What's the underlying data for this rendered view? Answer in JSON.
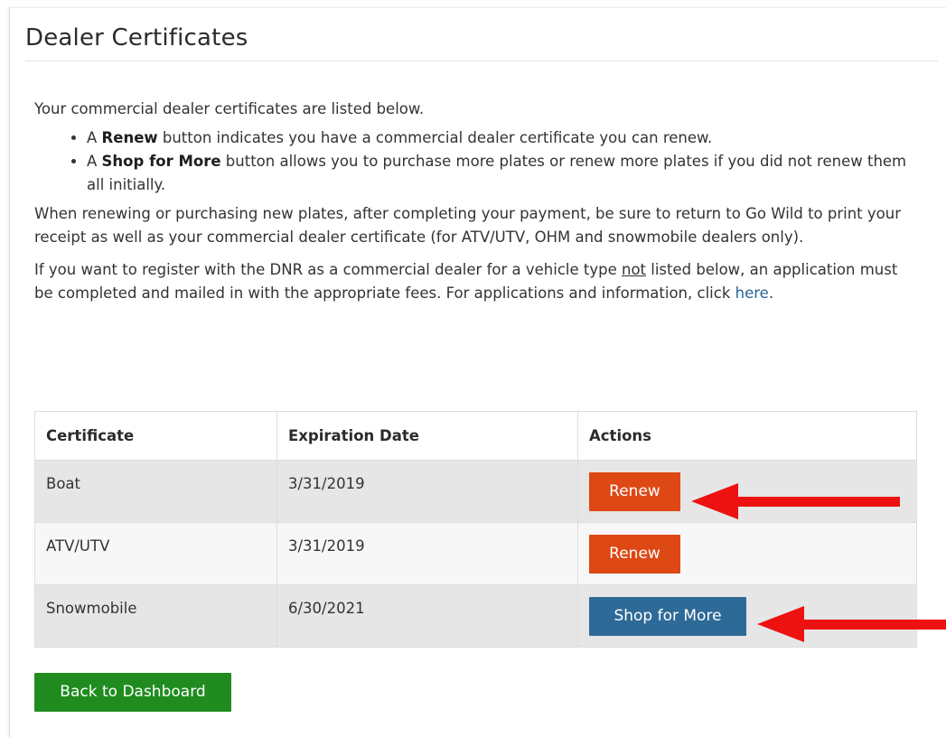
{
  "page": {
    "title": "Dealer Certificates",
    "intro": "Your commercial dealer certificates are listed below.",
    "bullets": [
      {
        "prefix": "A ",
        "bold": "Renew",
        "text": " button indicates you have a commercial dealer certificate you can renew."
      },
      {
        "prefix": "A ",
        "bold": "Shop for More",
        "text": " button allows you to purchase more plates or renew more plates if you did not renew them all initially."
      }
    ],
    "renewing_note": "When renewing or purchasing new plates, after completing your payment, be sure to return to Go Wild to print your receipt as well as your commercial dealer certificate (for ATV/UTV, OHM and snowmobile dealers only).",
    "register_note": {
      "before": "If you want to register with the DNR as a commercial dealer for a vehicle type ",
      "underlined": "not",
      "middle": " listed below, an application must be completed and mailed in with the appropriate fees. For applications and information, click ",
      "link": "here",
      "after": "."
    }
  },
  "table": {
    "headers": [
      "Certificate",
      "Expiration Date",
      "Actions"
    ],
    "rows": [
      {
        "certificate": "Boat",
        "expiration": "3/31/2019",
        "action": "Renew"
      },
      {
        "certificate": "ATV/UTV",
        "expiration": "3/31/2019",
        "action": "Renew"
      },
      {
        "certificate": "Snowmobile",
        "expiration": "6/30/2021",
        "action": "Shop for More"
      }
    ]
  },
  "buttons": {
    "back": "Back to Dashboard"
  },
  "colors": {
    "renew": "#dd4814",
    "shop": "#2e6a97",
    "back": "#208c1f",
    "annotation_arrow": "#ee1111"
  }
}
